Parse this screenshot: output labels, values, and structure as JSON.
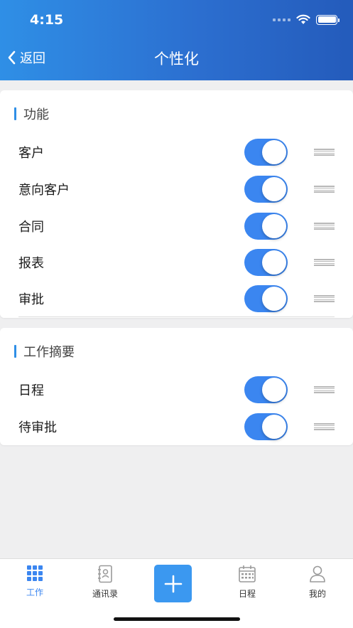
{
  "status_bar": {
    "time": "4:15"
  },
  "nav": {
    "back_label": "返回",
    "title": "个性化"
  },
  "sections": [
    {
      "title": "功能",
      "items": [
        {
          "label": "客户",
          "enabled": true
        },
        {
          "label": "意向客户",
          "enabled": true
        },
        {
          "label": "合同",
          "enabled": true
        },
        {
          "label": "报表",
          "enabled": true
        },
        {
          "label": "审批",
          "enabled": true
        }
      ]
    },
    {
      "title": "工作摘要",
      "items": [
        {
          "label": "日程",
          "enabled": true
        },
        {
          "label": "待审批",
          "enabled": true
        }
      ]
    }
  ],
  "tabbar": {
    "tabs": [
      {
        "label": "工作",
        "icon": "grid-icon",
        "active": true
      },
      {
        "label": "通讯录",
        "icon": "contacts-book-icon",
        "active": false
      },
      {
        "label": "日程",
        "icon": "calendar-icon",
        "active": false
      },
      {
        "label": "我的",
        "icon": "person-icon",
        "active": false
      }
    ],
    "center_button_icon": "plus-icon"
  },
  "colors": {
    "header_start": "#2f8fe6",
    "header_end": "#245bbb",
    "toggle_on": "#3b86f0",
    "active_tab": "#3b86f0",
    "plus_button": "#3b98f0"
  }
}
